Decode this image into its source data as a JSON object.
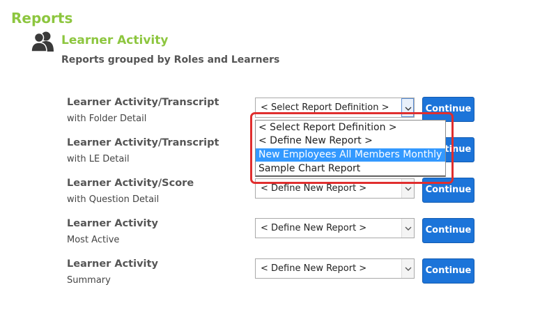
{
  "page": {
    "title": "Reports"
  },
  "section": {
    "title": "Learner Activity",
    "subtitle": "Reports grouped by Roles and Learners",
    "icon": "users-icon"
  },
  "reports": [
    {
      "title": "Learner Activity/Transcript",
      "subtitle": "with Folder Detail",
      "select_value": "< Select Report Definition >",
      "button": "Continue"
    },
    {
      "title": "Learner Activity/Transcript",
      "subtitle": "with LE Detail",
      "select_value": "",
      "button": "Continue"
    },
    {
      "title": "Learner Activity/Score",
      "subtitle": "with Question Detail",
      "select_value": "< Define New Report >",
      "button": "Continue"
    },
    {
      "title": "Learner Activity",
      "subtitle": "Most Active",
      "select_value": "< Define New Report >",
      "button": "Continue"
    },
    {
      "title": "Learner Activity",
      "subtitle": "Summary",
      "select_value": "< Define New Report >",
      "button": "Continue"
    }
  ],
  "dropdown": {
    "options": [
      "< Select Report Definition >",
      "< Define New Report >",
      "New Employees All Members Monthly",
      "Sample Chart Report"
    ],
    "highlighted": "New Employees All Members Monthly"
  },
  "colors": {
    "accent": "#8dc63f",
    "button": "#1c74d9",
    "annotation": "#e02e2e",
    "option_highlight": "#3399ff"
  }
}
